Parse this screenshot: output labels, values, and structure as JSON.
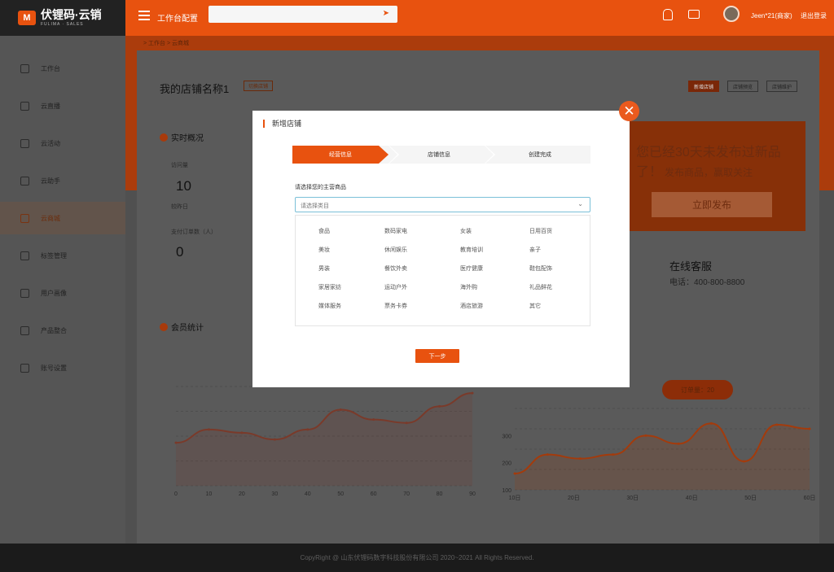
{
  "brand": {
    "name": "伏锂码·云销"
  },
  "header": {
    "title": "工作台配置",
    "user": "Jeen*21(商家)",
    "logout": "退出登录"
  },
  "sidebar": {
    "items": [
      {
        "label": "工作台"
      },
      {
        "label": "云直播"
      },
      {
        "label": "云活动"
      },
      {
        "label": "云助手"
      },
      {
        "label": "云商城",
        "active": true
      },
      {
        "label": "标签管理"
      },
      {
        "label": "用户画像"
      },
      {
        "label": "产品整合"
      },
      {
        "label": "账号设置"
      }
    ]
  },
  "breadcrumb": "> 工作台 > 云商城",
  "store": {
    "name": "我的店铺名称1",
    "switch": "切换店铺",
    "btn_new": "新增店铺",
    "btn_preview": "店铺预览",
    "btn_manage": "店铺维护"
  },
  "overview": {
    "title": "实时概况",
    "visit_label": "访问量",
    "visit_value": "10",
    "vs_label": "较昨日",
    "order_label": "支付订单数（人）",
    "order_value": "0"
  },
  "promo": {
    "title": "您已经30天未发布过新品了！",
    "subtitle": "发布商品，赢取关注",
    "button": "立即发布"
  },
  "service": {
    "title": "在线客服",
    "phone": "电话：400-800-8800"
  },
  "member": {
    "title": "会员统计"
  },
  "tooltip": "订单量：20",
  "chart_data": [
    {
      "type": "line",
      "x": [
        0,
        10,
        20,
        30,
        40,
        50,
        60,
        70,
        80,
        90
      ],
      "xticks": [
        "0",
        "10",
        "20",
        "30",
        "40",
        "50",
        "60",
        "70",
        "80",
        "90"
      ],
      "values": [
        26,
        34,
        32,
        28,
        34,
        46,
        40,
        38,
        48,
        56
      ],
      "ylim": [
        0,
        60
      ],
      "color": "#7a3a2a"
    },
    {
      "type": "line",
      "xticks": [
        "10日",
        "20日",
        "30日",
        "40日",
        "50日",
        "60日"
      ],
      "yticks": [
        "100",
        "200",
        "300"
      ],
      "values": [
        160,
        230,
        215,
        230,
        300,
        270,
        345,
        205,
        340,
        325
      ],
      "ylim": [
        100,
        400
      ],
      "color": "#a33b0c"
    }
  ],
  "modal": {
    "title": "新增店铺",
    "steps": [
      "经营信息",
      "店铺信息",
      "创建完成"
    ],
    "label": "请选择您的主营商品",
    "placeholder": "请选择类目",
    "options": [
      "食品",
      "数码家电",
      "女装",
      "日用百货",
      "美妆",
      "休闲娱乐",
      "教育培训",
      "亲子",
      "男装",
      "餐饮外卖",
      "医疗健康",
      "鞋包配饰",
      "家居家纺",
      "运动户外",
      "海外购",
      "礼品鲜花",
      "媒体服务",
      "票务卡券",
      "酒店旅游",
      "其它"
    ],
    "next": "下一步"
  },
  "footer": "CopyRight @ 山东伏锂码数字科技股份有限公司 2020~2021 All Rights Reserved."
}
